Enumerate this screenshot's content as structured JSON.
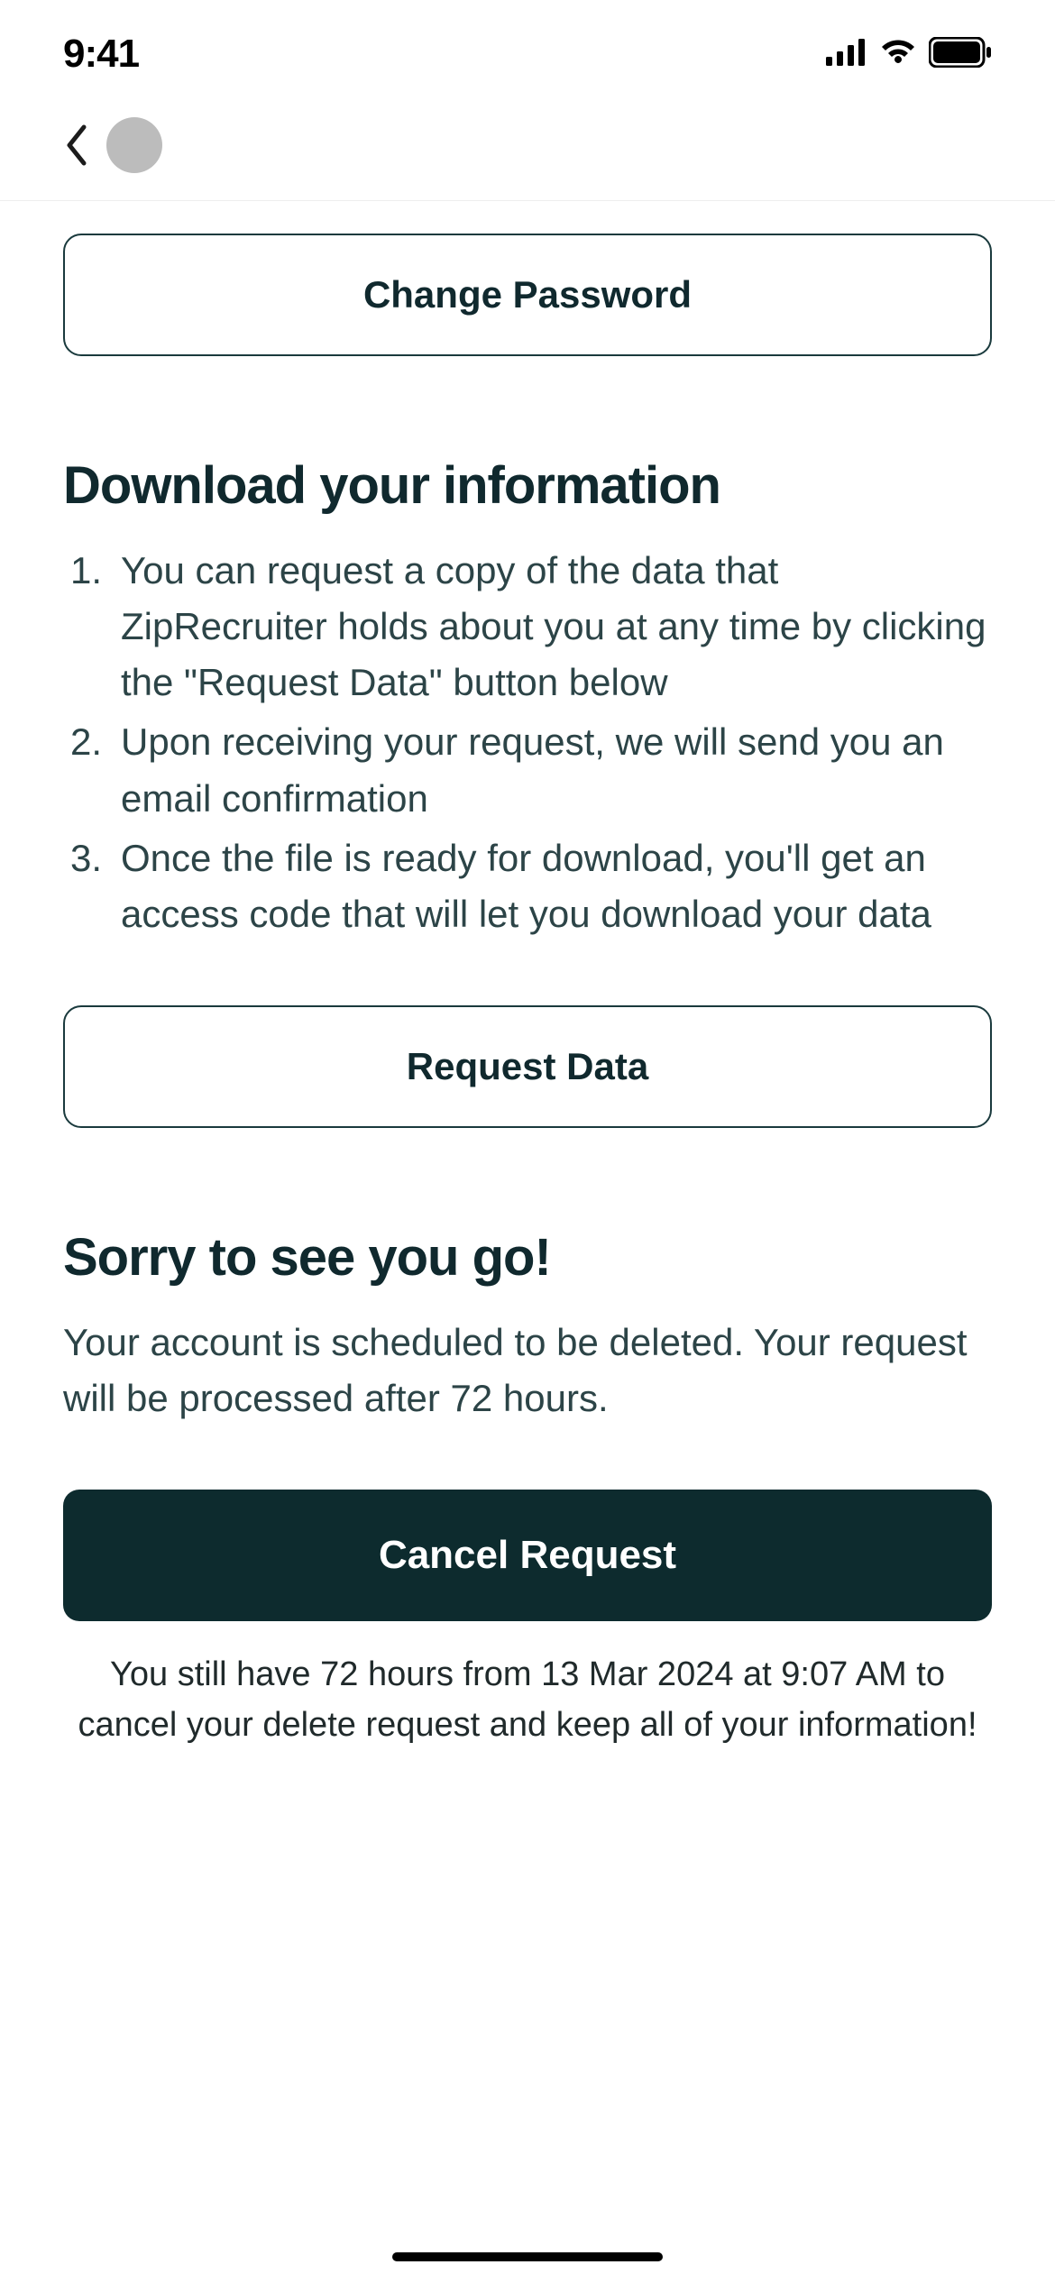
{
  "status": {
    "time": "9:41"
  },
  "buttons": {
    "change_password": "Change Password",
    "request_data": "Request Data",
    "cancel_request": "Cancel Request"
  },
  "download": {
    "title": "Download your information",
    "items": {
      "n1": "1.",
      "t1": "You can request a copy of the data that ZipRecruiter holds about you at any time by clicking the \"Request Data\" button below",
      "n2": "2.",
      "t2": "Upon receiving your request, we will send you an email confirmation",
      "n3": "3.",
      "t3": "Once the file is ready for download, you'll get an access code that will let you download your data"
    }
  },
  "delete": {
    "title": "Sorry to see you go!",
    "body": "Your account is scheduled to be deleted. Your request will be processed after 72 hours.",
    "footnote": "You still have 72 hours from 13 Mar 2024 at 9:07 AM to cancel your delete request and keep all of your information!"
  }
}
